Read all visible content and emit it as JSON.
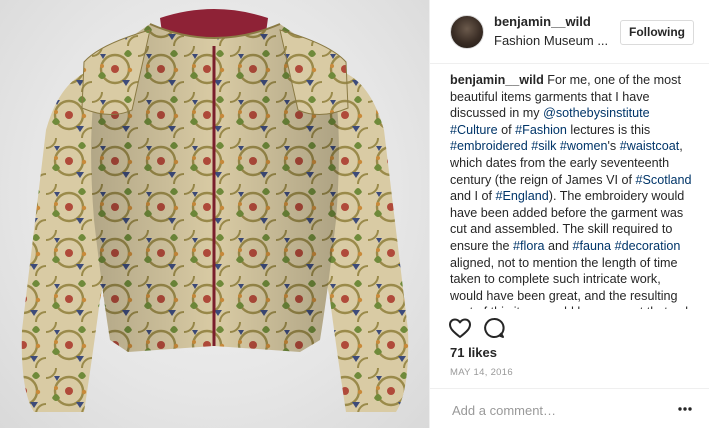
{
  "post": {
    "username": "benjamin__wild",
    "location": "Fashion Museum ...",
    "follow_label": "Following",
    "caption_parts": [
      {
        "text": "benjamin__wild",
        "kind": "user"
      },
      {
        "text": " For me, one of the most beautiful items garments that I have discussed in my ",
        "kind": "text"
      },
      {
        "text": "@sothebysinstitute",
        "kind": "link"
      },
      {
        "text": " ",
        "kind": "text"
      },
      {
        "text": "#Culture",
        "kind": "link"
      },
      {
        "text": " of ",
        "kind": "text"
      },
      {
        "text": "#Fashion",
        "kind": "link"
      },
      {
        "text": " lectures is this ",
        "kind": "text"
      },
      {
        "text": "#embroidered",
        "kind": "link"
      },
      {
        "text": " ",
        "kind": "text"
      },
      {
        "text": "#silk",
        "kind": "link"
      },
      {
        "text": " ",
        "kind": "text"
      },
      {
        "text": "#women",
        "kind": "link"
      },
      {
        "text": "'s ",
        "kind": "text"
      },
      {
        "text": "#waistcoat",
        "kind": "link"
      },
      {
        "text": ", which dates from the early seventeenth century (the reign of James VI of ",
        "kind": "text"
      },
      {
        "text": "#Scotland",
        "kind": "link"
      },
      {
        "text": " and I of ",
        "kind": "text"
      },
      {
        "text": "#England",
        "kind": "link"
      },
      {
        "text": "). The embroidery would have been added before the garment was cut and assembled. The skill required to ensure the ",
        "kind": "text"
      },
      {
        "text": "#flora",
        "kind": "link"
      },
      {
        "text": " and ",
        "kind": "text"
      },
      {
        "text": "#fauna",
        "kind": "link"
      },
      {
        "text": " ",
        "kind": "text"
      },
      {
        "text": "#decoration",
        "kind": "link"
      },
      {
        "text": " aligned, not to mention the length of time taken to complete such intricate work, would have been great, and the resulting cost of this item would have meant that only the very wealthy could afford it. A gem from",
        "kind": "text"
      }
    ],
    "likes": "71 likes",
    "date": "MAY 14, 2016",
    "comment_placeholder": "Add a comment…"
  },
  "icons": {
    "like": "heart-outline-icon",
    "comment": "speech-bubble-icon",
    "more": "more-dots-icon"
  },
  "colors": {
    "link": "#003569",
    "text": "#262626",
    "muted": "#999999",
    "border": "#efefef"
  }
}
